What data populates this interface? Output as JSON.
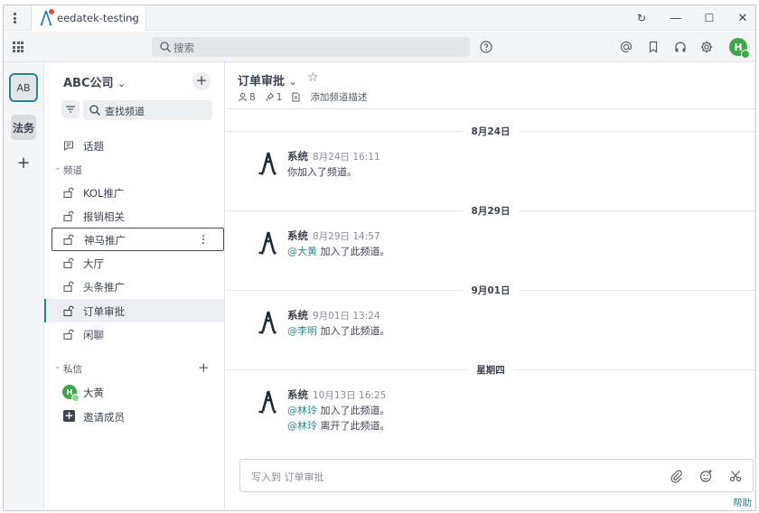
{
  "titlebar": {
    "workspace_tab": "eedatek-testing",
    "minimize_glyph": "—",
    "maximize_glyph": "☐",
    "close_glyph": "✕",
    "refresh_glyph": "↻"
  },
  "header": {
    "search_placeholder": "搜索",
    "user_initial": "H"
  },
  "teams": {
    "items": [
      {
        "label": "AB",
        "active": true
      },
      {
        "label": "法务",
        "active": false
      }
    ],
    "add": "+"
  },
  "sidebar": {
    "team_name": "ABC公司",
    "team_chevron": "⌄",
    "add": "+",
    "find_channel": "查找频道",
    "threads_label": "话题",
    "channels_section": "频道",
    "channels": [
      {
        "label": "KOL推广"
      },
      {
        "label": "报销相关"
      },
      {
        "label": "神马推广"
      },
      {
        "label": "大厅"
      },
      {
        "label": "头条推广"
      },
      {
        "label": "订单审批"
      },
      {
        "label": "闲聊"
      }
    ],
    "dm_section": "私信",
    "dm_add": "+",
    "dms": [
      {
        "label": "大黄",
        "initial": "H"
      }
    ],
    "invite_label": "邀请成员"
  },
  "channel": {
    "title": "订单审批",
    "chevron": "⌄",
    "members": "8",
    "pinned": "1",
    "add_description": "添加频道描述"
  },
  "posts": [
    {
      "date": "8月24日",
      "author": "系统",
      "time": "8月24日 16:11",
      "lines": [
        {
          "mention": "",
          "text": "你加入了频道。"
        }
      ]
    },
    {
      "date": "8月29日",
      "author": "系统",
      "time": "8月29日 14:57",
      "lines": [
        {
          "mention": "@大黄",
          "text": " 加入了此频道。"
        }
      ]
    },
    {
      "date": "9月01日",
      "author": "系统",
      "time": "9月01日 13:24",
      "lines": [
        {
          "mention": "@李明",
          "text": " 加入了此频道。"
        }
      ]
    },
    {
      "date": "星期四",
      "author": "系统",
      "time": "10月13日 16:25",
      "lines": [
        {
          "mention": "@林玲",
          "text": " 加入了此频道。"
        },
        {
          "mention": "@林玲",
          "text": " 离开了此频道。"
        }
      ]
    }
  ],
  "composer": {
    "placeholder": "写入到 订单审批"
  },
  "footer": {
    "help": "帮助"
  },
  "colors": {
    "accent": "#28878a",
    "online": "#3aa74b",
    "notification_dot": "#e24b3c"
  }
}
